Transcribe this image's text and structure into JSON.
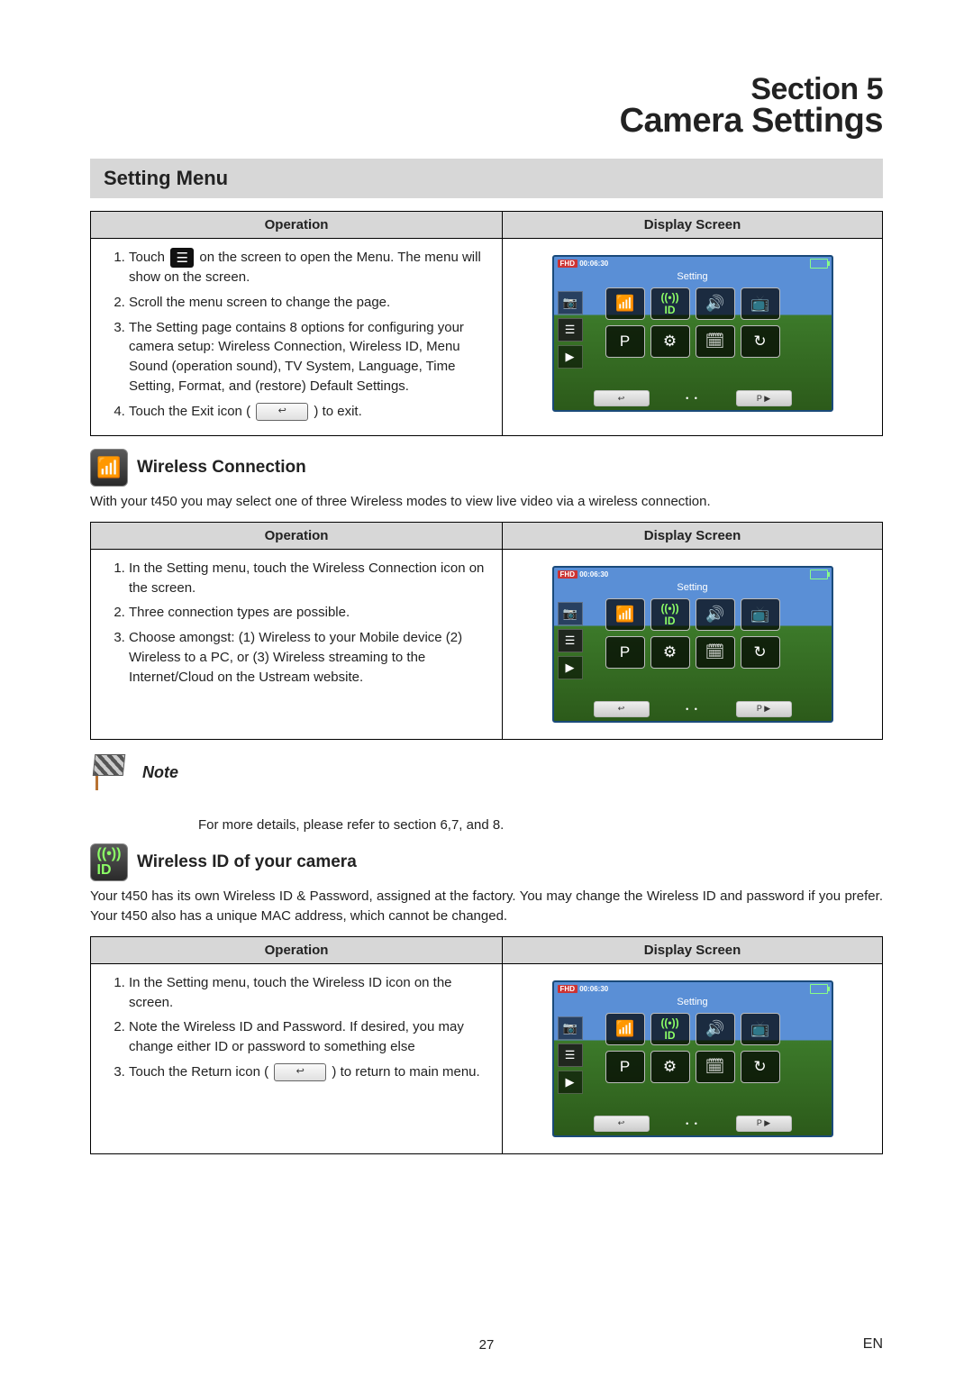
{
  "section": {
    "label": "Section 5",
    "title": "Camera Settings"
  },
  "setting_menu_heading": "Setting Menu",
  "table_headers": {
    "operation": "Operation",
    "display_screen": "Display Screen"
  },
  "table1_steps": [
    "Touch [MENU ICON] on the screen to open the Menu. The menu will show on the screen.",
    "Scroll the menu screen to change the page.",
    "The Setting page contains 8 options for configuring your camera setup: Wireless Connection, Wireless ID, Menu Sound (operation sound), TV System, Language, Time Setting, Format, and (restore) Default Settings.",
    "Touch the Exit icon ( [EXIT ICON] ) to exit."
  ],
  "wireless_connection": {
    "heading": "Wireless Connection",
    "intro": "With your t450 you may select one of three Wireless modes to view live video via a wireless connection.",
    "steps": [
      "In the Setting menu, touch the Wireless Connection  icon on the screen.",
      "Three connection types are possible.",
      "Choose amongst: (1) Wireless to your Mobile device (2) Wireless to a PC, or (3) Wireless streaming to the Internet/Cloud on the Ustream website."
    ]
  },
  "note": {
    "label": "Note",
    "text": "For more details, please refer to section 6,7, and 8."
  },
  "wireless_id": {
    "heading": "Wireless ID of your camera",
    "intro": "Your t450 has its own Wireless ID & Password, assigned at the factory.  You may change the Wireless ID and password if you prefer.  Your t450 also has a unique MAC address, which cannot be changed.",
    "steps": [
      "In the Setting menu, touch the Wireless ID  icon on the screen.",
      "Note the Wireless ID and Password.  If desired, you may change either ID or password to something else",
      "Touch the Return icon ( [EXIT ICON] ) to return to main menu."
    ]
  },
  "camera_screen": {
    "time": "00:06:30",
    "fhd_label": "FHD",
    "setting_label": "Setting",
    "pb_label": "P ▶",
    "back_label": "↩"
  },
  "footer": {
    "page_number": "27",
    "lang": "EN"
  }
}
